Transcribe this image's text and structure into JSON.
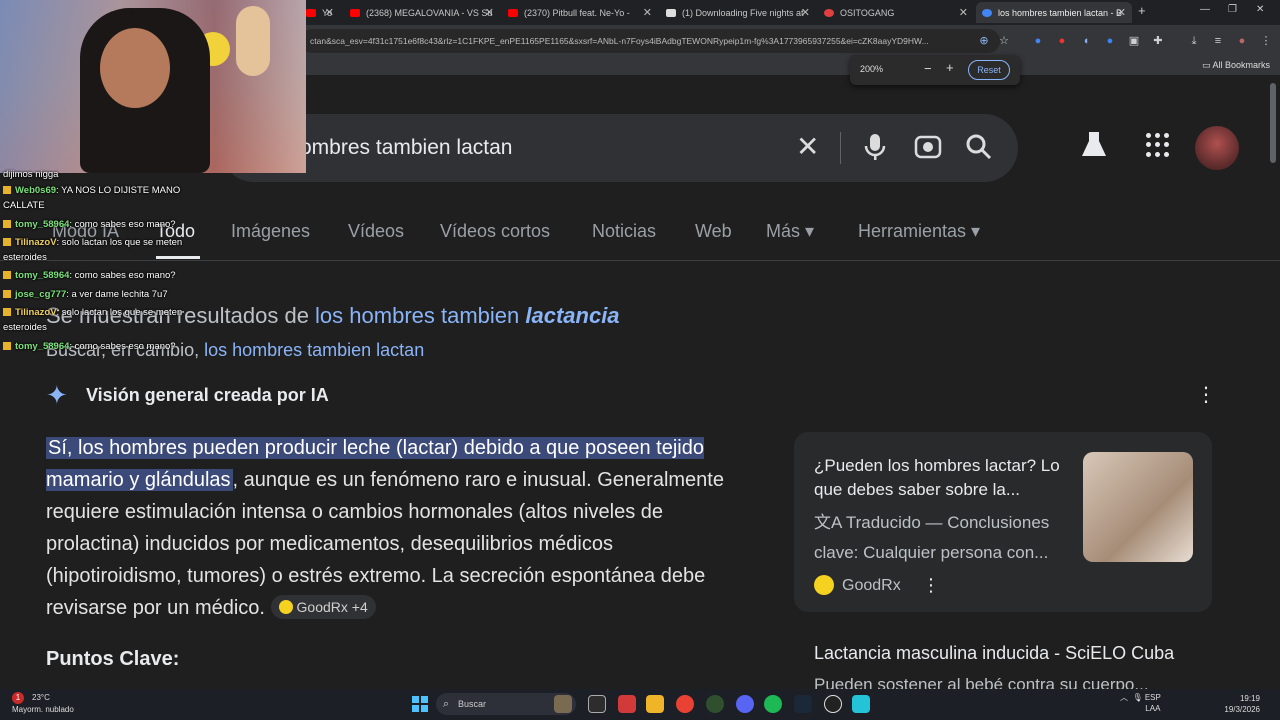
{
  "browser": {
    "tabs": [
      {
        "label": "Yo",
        "color": "#ff0000"
      },
      {
        "label": "(2368) MEGALOVANIA - VS Su",
        "color": "#ff0000"
      },
      {
        "label": "(2370) Pitbull feat. Ne-Yo -",
        "color": "#ff0000"
      },
      {
        "label": "(1) Downloading Five nights at",
        "color": "#dddddd"
      },
      {
        "label": "OSITOGANG",
        "color": "#e04040"
      },
      {
        "label": "los hombres tambien lactan - B",
        "color": "#4285f4"
      }
    ],
    "url": "ctan&sca_esv=4f31c1751e6f8c43&rlz=1C1FKPE_enPE1165PE1165&sxsrf=ANbL-n7Foys4iBAdbgTEWONRypeip1m-fg%3A1773965937255&ei=cZK8aayYD9HW...",
    "all_bookmarks": "All Bookmarks",
    "zoom": {
      "percent": "200%",
      "minus": "−",
      "plus": "+",
      "reset": "Reset"
    }
  },
  "google": {
    "query": "ombres tambien lactan",
    "nav_tabs": [
      "Modo IA",
      "Todo",
      "Imágenes",
      "Vídeos",
      "Vídeos cortos",
      "Noticias",
      "Web",
      "Más ▾",
      "Herramientas ▾"
    ],
    "showing_prefix": "Se muestran resultados de ",
    "showing_link": "los hombres tambien ",
    "showing_bold": "lactancia",
    "instead_prefix": "Buscar, en cambio, ",
    "instead_link": "los hombres tambien lactan",
    "ai_overview_title": "Visión general creada por IA",
    "ai_highlight": "Sí, los hombres pueden producir leche (lactar) debido a que poseen tejido mamario y glándulas",
    "ai_rest": ", aunque es un fenómeno raro e inusual. Generalmente requiere estimulación intensa o cambios hormonales (altos niveles de prolactina) inducidos por medicamentos, desequilibrios médicos (hipotiroidismo, tumores) o estrés extremo. La secreción espontánea debe revisarse por un médico. ",
    "ai_source_chip": "GoodRx +4",
    "key_points": "Puntos Clave:",
    "card1": {
      "title": "¿Pueden los hombres lactar? Lo que debes saber sobre la...",
      "snippet": "Traducido — Conclusiones clave: Cualquier persona con...",
      "source": "GoodRx"
    },
    "card2": {
      "title": "Lactancia masculina inducida - SciELO Cuba",
      "snippet": "Pueden sostener al bebé contra su cuerpo..."
    }
  },
  "chat": [
    {
      "user": "",
      "msg": "dijimos nigga"
    },
    {
      "user": "Web0s69",
      "msg": ": YA NOS LO DIJISTE MANO"
    },
    {
      "user": "",
      "msg": "CALLATE"
    },
    {
      "user": "tomy_58964",
      "msg": ": como sabes eso mano?"
    },
    {
      "user": "TilinazoV",
      "msg": ": solo lactan los que se meten"
    },
    {
      "user": "",
      "msg": "esteroides"
    },
    {
      "user": "tomy_58964",
      "msg": ": como sabes eso mano?"
    },
    {
      "user": "jose_cg777",
      "msg": ": a ver dame lechita 7u7"
    },
    {
      "user": "TilinazoV",
      "msg": ": solo lactan los que se meten"
    },
    {
      "user": "",
      "msg": "esteroides"
    },
    {
      "user": "tomy_58964",
      "msg": ": como sabes eso mano?"
    }
  ],
  "taskbar": {
    "temp": "23°C",
    "weather": "Mayorm. nublado",
    "search": "Buscar",
    "lang1": "ESP",
    "lang2": "LAA",
    "time": "19:19",
    "date": "19/3/2026"
  }
}
